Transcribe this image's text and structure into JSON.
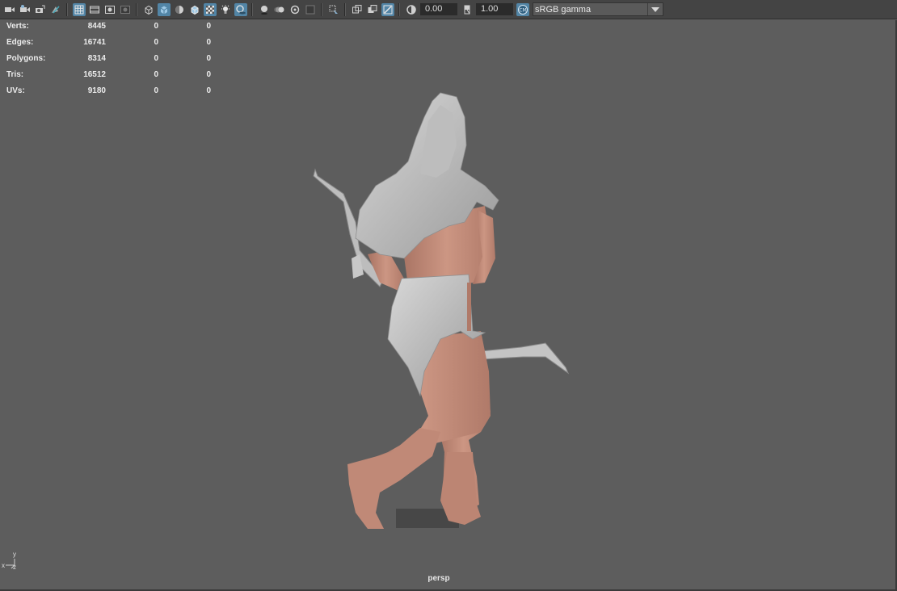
{
  "toolbar": {
    "icons": [
      "camera-icon",
      "camera-attributes-icon",
      "bookmark-icon",
      "image-plane-icon",
      "grease-pencil-icon",
      "grid-icon",
      "film-gate-icon",
      "resolution-gate-icon",
      "gate-mask-icon",
      "field-chart-icon",
      "wireframe-icon",
      "smooth-shade-icon",
      "default-material-icon",
      "wireframe-on-shaded-icon",
      "textured-icon",
      "use-all-lights-icon",
      "shadows-icon",
      "screen-space-ao-icon",
      "motion-blur-icon",
      "multisample-aa-icon",
      "depth-of-field-icon",
      "isolate-select-icon",
      "xray-icon",
      "xray-active-components-icon",
      "xray-joints-icon",
      "exposure-icon",
      "gamma-icon",
      "color-management-icon"
    ],
    "exposure_value": "0.00",
    "gamma_value": "1.00",
    "color_space": "sRGB gamma"
  },
  "hud": {
    "rows": [
      {
        "label": "Verts:",
        "v1": "8445",
        "v2": "0",
        "v3": "0"
      },
      {
        "label": "Edges:",
        "v1": "16741",
        "v2": "0",
        "v3": "0"
      },
      {
        "label": "Polygons:",
        "v1": "8314",
        "v2": "0",
        "v3": "0"
      },
      {
        "label": "Tris:",
        "v1": "16512",
        "v2": "0",
        "v3": "0"
      },
      {
        "label": "UVs:",
        "v1": "9180",
        "v2": "0",
        "v3": "0"
      }
    ]
  },
  "viewport": {
    "camera": "persp",
    "axis_y": "y",
    "axis_x": "x",
    "axis_z": "z",
    "background": "#5d5d5d",
    "skin_color": "#c7907e",
    "cloth_color": "#c9c9c9",
    "active_color": "#5285a6"
  }
}
